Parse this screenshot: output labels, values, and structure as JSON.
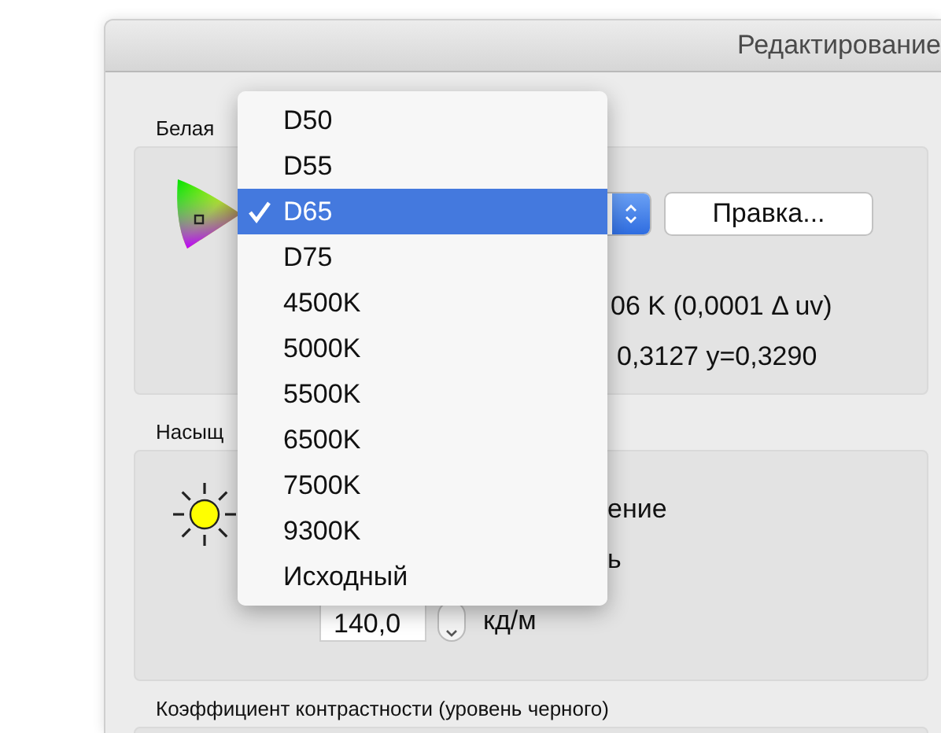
{
  "window": {
    "title": "Редактирование"
  },
  "white_point": {
    "label": "Белая",
    "edit_button": "Правка...",
    "color_temp_fragment": "06 K (0,0001 Δ uv)",
    "cie_fragment": "0,3127 y=0,3290"
  },
  "luminance": {
    "label": "Насыщ",
    "option_fragments": [
      "ение",
      "ь"
    ],
    "value": "140,0",
    "unit": "кд/м"
  },
  "contrast": {
    "label": "Коэффициент контрастности (уровень черного)"
  },
  "menu": {
    "items": [
      {
        "label": "D50",
        "selected": false
      },
      {
        "label": "D55",
        "selected": false
      },
      {
        "label": "D65",
        "selected": true
      },
      {
        "label": "D75",
        "selected": false
      },
      {
        "label": "4500K",
        "selected": false
      },
      {
        "label": "5000K",
        "selected": false
      },
      {
        "label": "5500K",
        "selected": false
      },
      {
        "label": "6500K",
        "selected": false
      },
      {
        "label": "7500K",
        "selected": false
      },
      {
        "label": "9300K",
        "selected": false
      },
      {
        "label": "Исходный",
        "selected": false
      }
    ]
  }
}
